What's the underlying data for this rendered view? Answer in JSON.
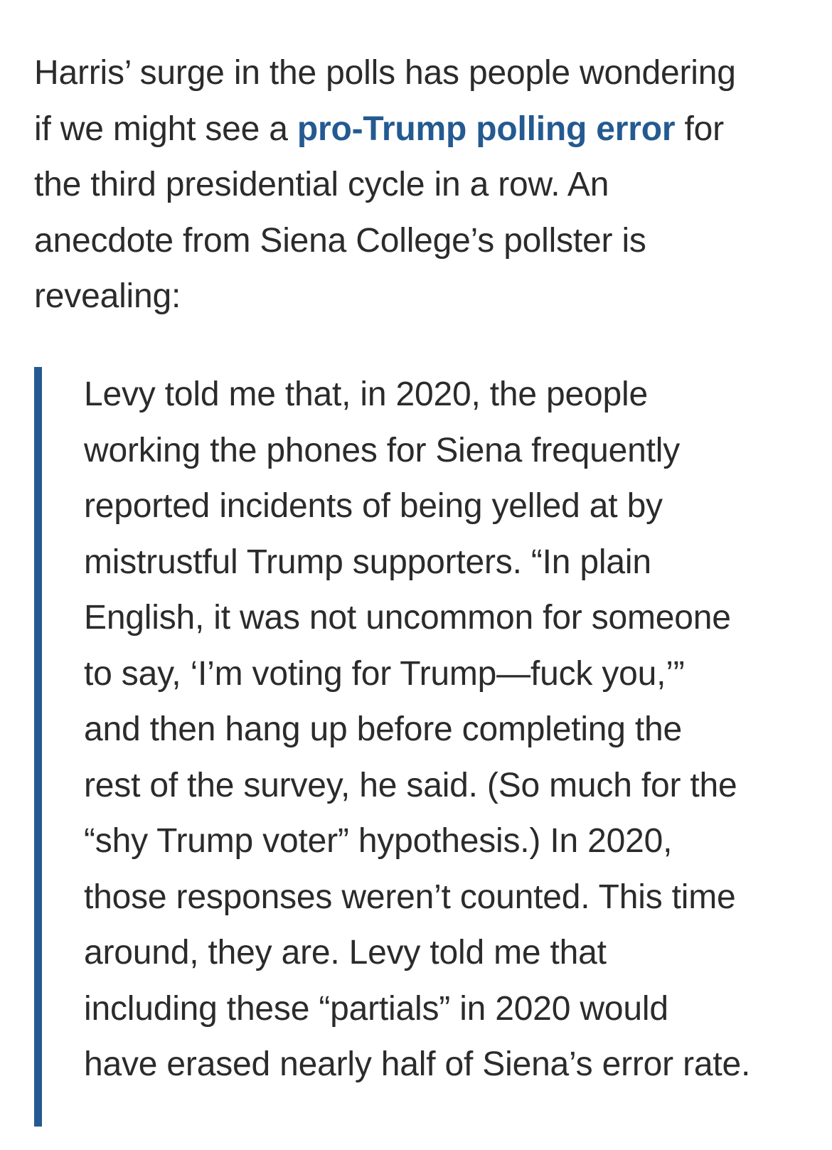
{
  "intro": {
    "lines": [
      "Harris’ surge in the polls has people wondering",
      "if we might see a ",
      " for",
      "the third presidential cycle in a row. An",
      "anecdote from Siena College’s pollster is",
      "revealing:"
    ],
    "link_text": "pro-Trump polling error",
    "link_color": "#245a91"
  },
  "quote": {
    "bar_color": "#245a91",
    "lines": [
      "Levy told me that, in 2020, the people",
      "working the phones for Siena frequently",
      "reported incidents of being yelled at by",
      "mistrustful Trump supporters. “In plain",
      "English, it was not uncommon for someone",
      "to say, ‘I’m voting for Trump—fuck you,’”",
      "and then hang up before completing the",
      "rest of the survey, he said. (So much for the",
      "“shy Trump voter” hypothesis.) In 2020,",
      "those responses weren’t counted. This time",
      "around, they are. Levy told me that",
      "including these “partials” in 2020 would",
      "have erased nearly half of Siena’s error rate."
    ]
  }
}
